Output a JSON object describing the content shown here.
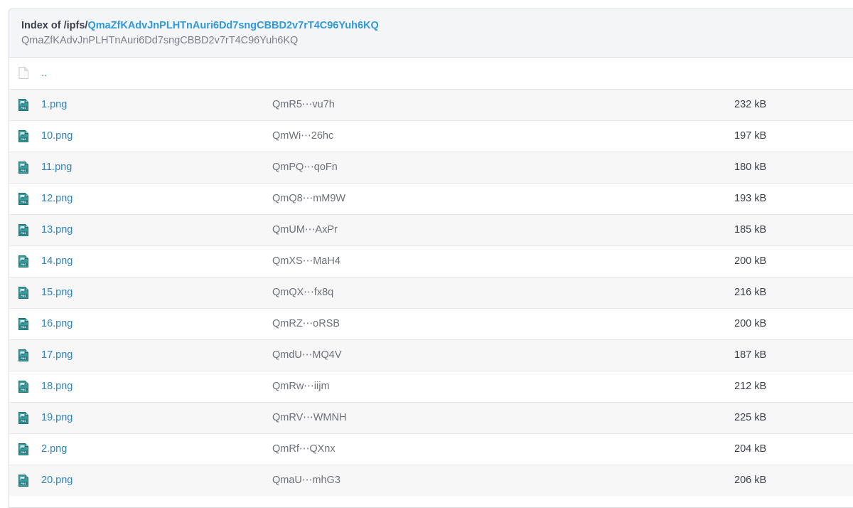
{
  "header": {
    "prefix": "Index of /ipfs/",
    "cid": "QmaZfKAdvJnPLHTnAuri6Dd7sngCBBD2v7rT4C96Yuh6KQ",
    "subtitle": "QmaZfKAdvJnPLHTnAuri6Dd7sngCBBD2v7rT4C96Yuh6KQ"
  },
  "parent": {
    "label": "..",
    "icon": "blank-file-icon"
  },
  "files": [
    {
      "name": "1.png",
      "hash": "QmR5⋯vu7h",
      "size": "232 kB",
      "icon": "png-file-icon"
    },
    {
      "name": "10.png",
      "hash": "QmWi⋯26hc",
      "size": "197 kB",
      "icon": "png-file-icon"
    },
    {
      "name": "11.png",
      "hash": "QmPQ⋯qoFn",
      "size": "180 kB",
      "icon": "png-file-icon"
    },
    {
      "name": "12.png",
      "hash": "QmQ8⋯mM9W",
      "size": "193 kB",
      "icon": "png-file-icon"
    },
    {
      "name": "13.png",
      "hash": "QmUM⋯AxPr",
      "size": "185 kB",
      "icon": "png-file-icon"
    },
    {
      "name": "14.png",
      "hash": "QmXS⋯MaH4",
      "size": "200 kB",
      "icon": "png-file-icon"
    },
    {
      "name": "15.png",
      "hash": "QmQX⋯fx8q",
      "size": "216 kB",
      "icon": "png-file-icon"
    },
    {
      "name": "16.png",
      "hash": "QmRZ⋯oRSB",
      "size": "200 kB",
      "icon": "png-file-icon"
    },
    {
      "name": "17.png",
      "hash": "QmdU⋯MQ4V",
      "size": "187 kB",
      "icon": "png-file-icon"
    },
    {
      "name": "18.png",
      "hash": "QmRw⋯iijm",
      "size": "212 kB",
      "icon": "png-file-icon"
    },
    {
      "name": "19.png",
      "hash": "QmRV⋯WMNH",
      "size": "225 kB",
      "icon": "png-file-icon"
    },
    {
      "name": "2.png",
      "hash": "QmRf⋯QXnx",
      "size": "204 kB",
      "icon": "png-file-icon"
    },
    {
      "name": "20.png",
      "hash": "QmaU⋯mhG3",
      "size": "206 kB",
      "icon": "png-file-icon"
    }
  ],
  "colors": {
    "link": "#2f83b9",
    "header_link": "#2f9ad8",
    "icon_teal": "#2c8a8c"
  }
}
